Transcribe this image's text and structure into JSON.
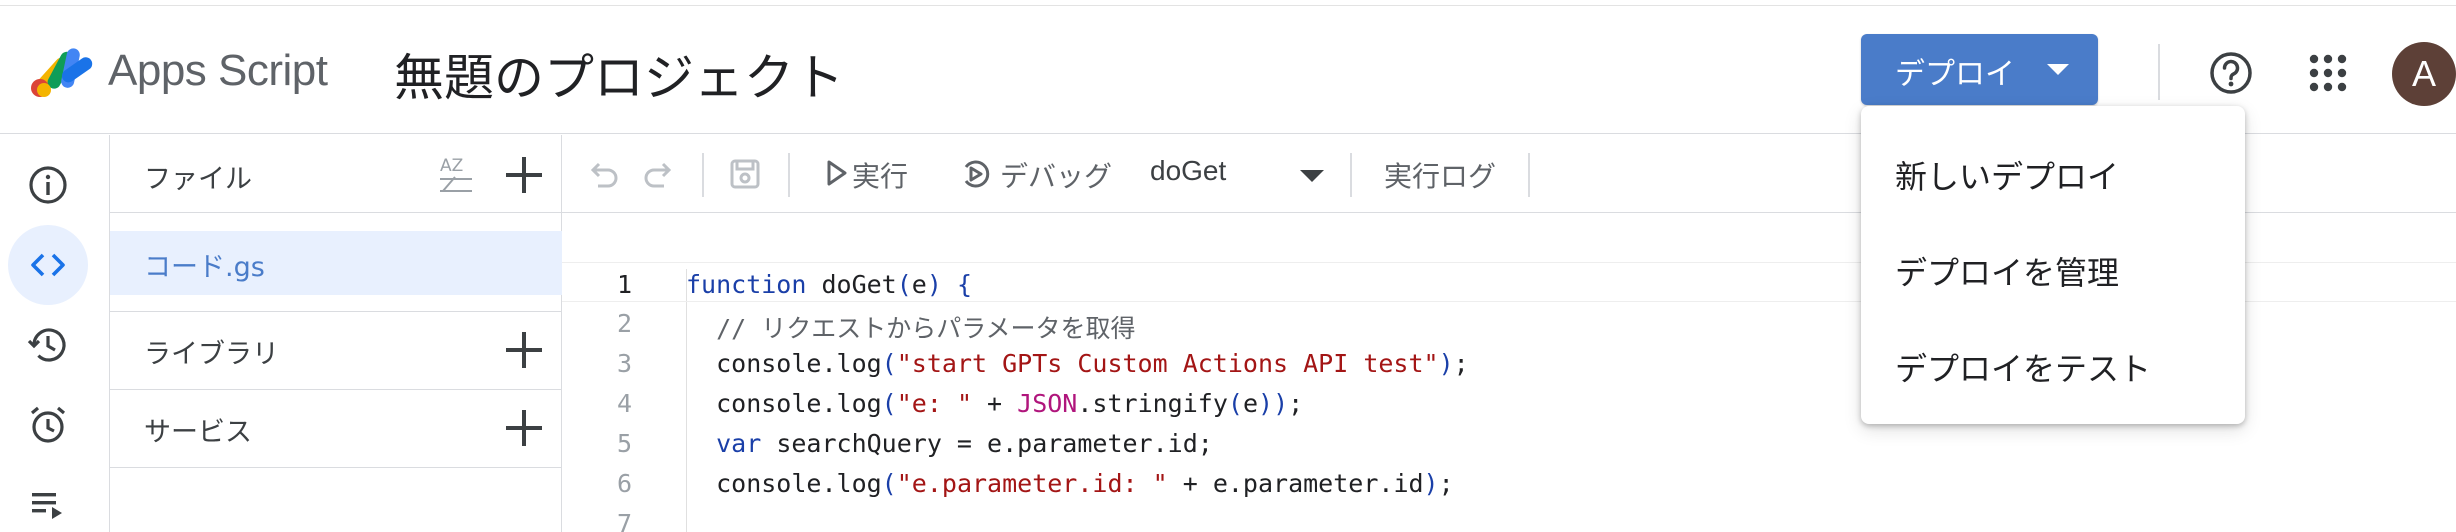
{
  "header": {
    "app_name": "Apps Script",
    "project_title": "無題のプロジェクト",
    "deploy_label": "デプロイ",
    "avatar_initial": "A"
  },
  "colors": {
    "accent": "#4a7cc9",
    "avatar_bg": "#5d4037"
  },
  "rail": {
    "items": [
      {
        "icon": "info-icon"
      },
      {
        "icon": "code-icon",
        "active": true
      },
      {
        "icon": "history-icon"
      },
      {
        "icon": "alarm-icon"
      },
      {
        "icon": "executions-icon"
      }
    ]
  },
  "files_panel": {
    "files_label": "ファイル",
    "sort_label": "AZ",
    "file_name": "コード.gs",
    "libraries_label": "ライブラリ",
    "services_label": "サービス"
  },
  "toolbar": {
    "run_label": "実行",
    "debug_label": "デバッグ",
    "function_selected": "doGet",
    "log_label": "実行ログ"
  },
  "code": {
    "line_numbers": [
      "1",
      "2",
      "3",
      "4",
      "5",
      "6",
      "7"
    ],
    "lines": [
      "function doGet(e) {",
      "  // リクエストからパラメータを取得",
      "  console.log(\"start GPTs Custom Actions API test\");",
      "  console.log(\"e: \" + JSON.stringify(e));",
      "  var searchQuery = e.parameter.id;",
      "  console.log(\"e.parameter.id: \" + e.parameter.id);",
      ""
    ]
  },
  "deploy_menu": {
    "items": [
      "新しいデプロイ",
      "デプロイを管理",
      "デプロイをテスト"
    ]
  }
}
